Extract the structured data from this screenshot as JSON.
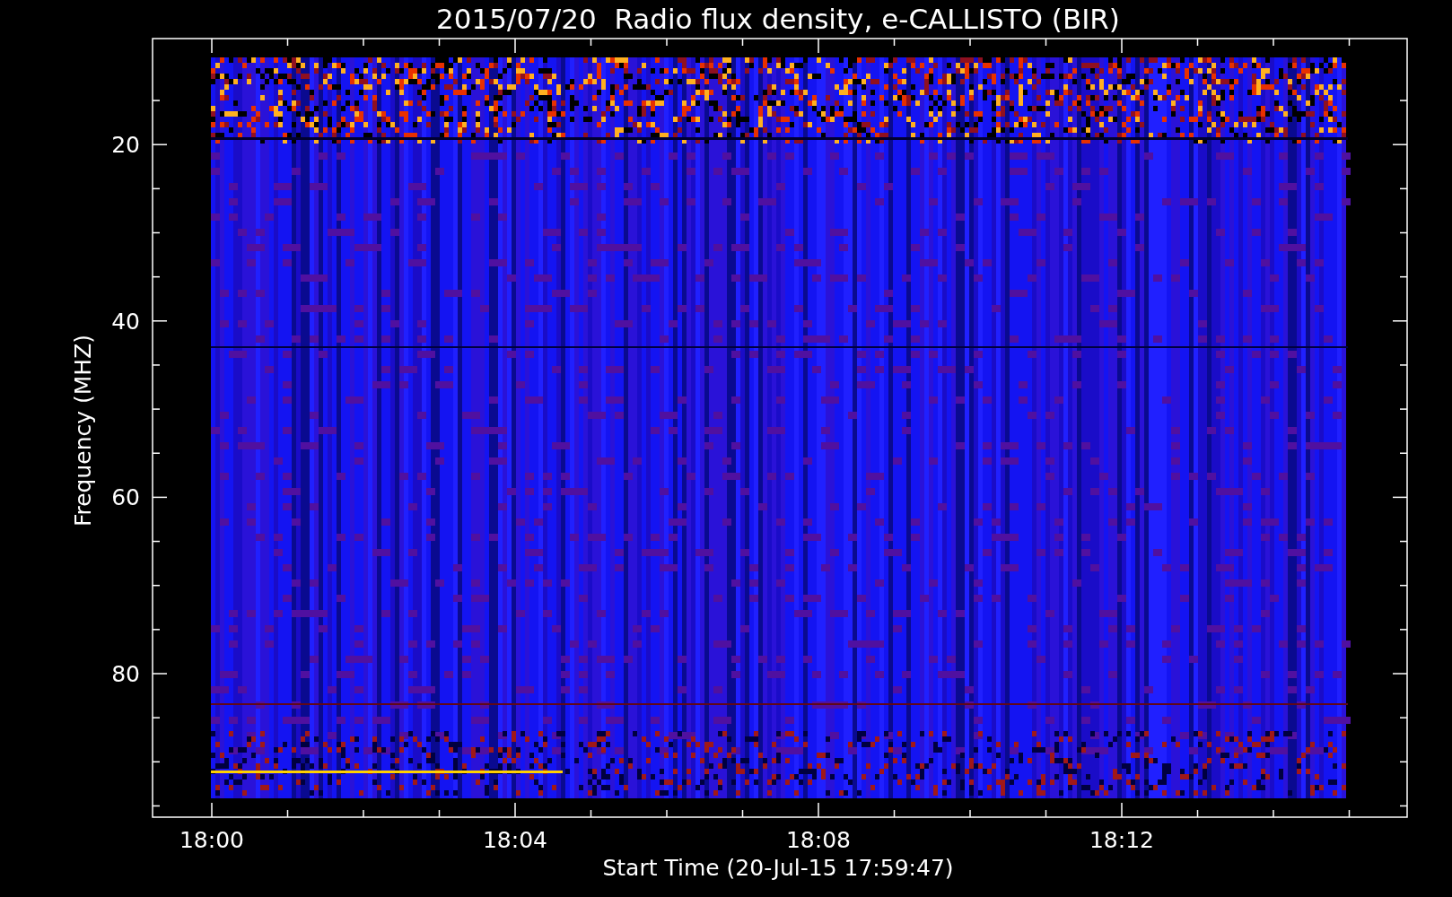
{
  "plot": {
    "title": "2015/07/20  Radio flux density, e-CALLISTO (BIR)",
    "y_axis": {
      "label": "Frequency (MHZ)",
      "ticks": [
        "20",
        "40",
        "60",
        "80"
      ]
    },
    "x_axis": {
      "label": "Start Time (20-Jul-15 17:59:47)",
      "ticks": [
        "18:00",
        "18:04",
        "18:08",
        "18:12"
      ]
    }
  }
}
